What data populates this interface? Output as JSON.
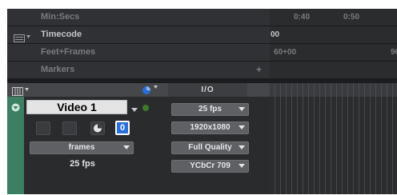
{
  "rulers": [
    {
      "label": "Min:Secs",
      "ticks": [
        "0:40",
        "0:50"
      ]
    },
    {
      "label": "Timecode",
      "ticks": [
        "00"
      ]
    },
    {
      "label": "Feet+Frames",
      "ticks": [
        "60+00",
        "90"
      ]
    },
    {
      "label": "Markers",
      "ticks": []
    }
  ],
  "markers_add_symbol": "+",
  "header": {
    "io_title": "I/O"
  },
  "track": {
    "name": "Video 1",
    "solo_label": "0",
    "timebase_popup": "frames",
    "rate_text": "25 fps",
    "io_popups": [
      "25 fps",
      "1920x1080",
      "Full Quality",
      "YCbCr 709"
    ]
  },
  "colors": {
    "track_color": "#3d7f62",
    "accent_blue": "#2a6fd6",
    "name_field": "#e4e4e4"
  }
}
